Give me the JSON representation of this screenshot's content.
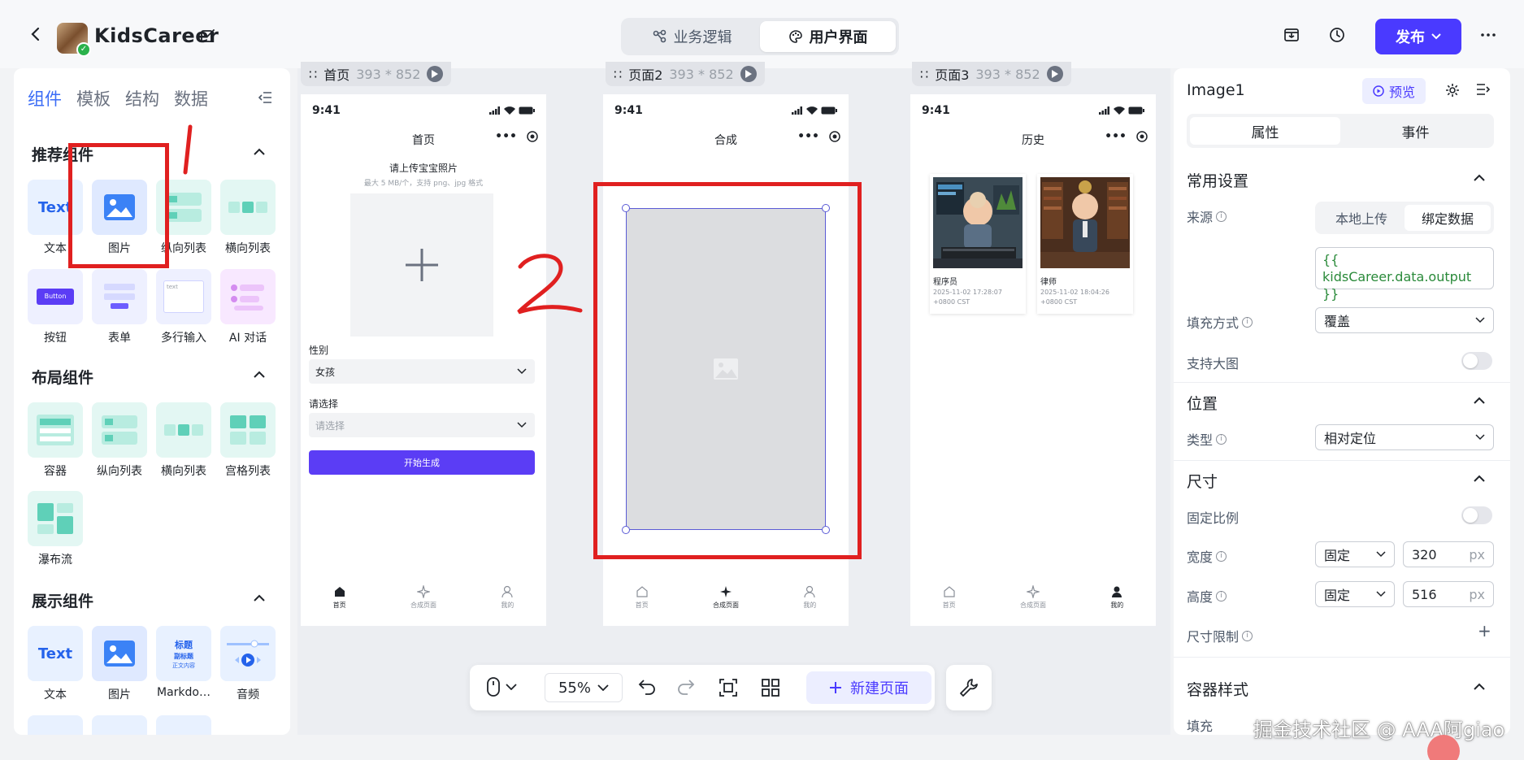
{
  "header": {
    "app_name": "KidsCareer",
    "modes": [
      {
        "label": "业务逻辑"
      },
      {
        "label": "用户界面"
      }
    ],
    "publish_label": "发布"
  },
  "left_panel": {
    "tabs": [
      "组件",
      "模板",
      "结构",
      "数据"
    ],
    "sections": {
      "recommended": {
        "title": "推荐组件",
        "items": [
          {
            "label": "文本",
            "icon": "text-icon",
            "thumb_text": "Text"
          },
          {
            "label": "图片",
            "icon": "image-icon"
          },
          {
            "label": "纵向列表",
            "icon": "vertical-list-icon"
          },
          {
            "label": "横向列表",
            "icon": "horizontal-list-icon"
          },
          {
            "label": "按钮",
            "icon": "button-icon",
            "thumb_text": "Button"
          },
          {
            "label": "表单",
            "icon": "form-icon"
          },
          {
            "label": "多行输入",
            "icon": "textarea-icon",
            "thumb_text": "text"
          },
          {
            "label": "AI 对话",
            "icon": "ai-chat-icon"
          }
        ]
      },
      "layout": {
        "title": "布局组件",
        "items": [
          {
            "label": "容器",
            "icon": "container-icon"
          },
          {
            "label": "纵向列表",
            "icon": "vertical-list-icon"
          },
          {
            "label": "横向列表",
            "icon": "horizontal-list-icon"
          },
          {
            "label": "宫格列表",
            "icon": "grid-list-icon"
          },
          {
            "label": "瀑布流",
            "icon": "waterfall-icon"
          }
        ]
      },
      "display": {
        "title": "展示组件",
        "items": [
          {
            "label": "文本",
            "icon": "text-icon",
            "thumb_text": "Text"
          },
          {
            "label": "图片",
            "icon": "image-icon"
          },
          {
            "label": "Markdo…",
            "icon": "markdown-icon",
            "thumb_lines": [
              "标题",
              "副标题",
              "正文内容"
            ]
          },
          {
            "label": "音频",
            "icon": "audio-icon"
          }
        ]
      }
    }
  },
  "canvas": {
    "pages": [
      {
        "name": "首页",
        "size": "393 * 852"
      },
      {
        "name": "页面2",
        "size": "393 * 852"
      },
      {
        "name": "页面3",
        "size": "393 * 852"
      }
    ],
    "status_time": "9:41",
    "page1": {
      "title": "首页",
      "upload_title": "请上传宝宝照片",
      "upload_hint": "最大 5 MB/个，支持 png、jpg 格式",
      "gender_label": "性别",
      "gender_value": "女孩",
      "select_label": "请选择",
      "select_placeholder": "请选择",
      "generate_button": "开始生成"
    },
    "page2": {
      "title": "合成"
    },
    "page3": {
      "title": "历史",
      "cards": [
        {
          "name": "程序员",
          "time": "2025-11-02 17:28:07 +0800 CST"
        },
        {
          "name": "律师",
          "time": "2025-11-02 18:04:26 +0800 CST"
        }
      ]
    },
    "tabbar": [
      {
        "label": "首页"
      },
      {
        "label": "合成页面"
      },
      {
        "label": "我的"
      }
    ],
    "annotations": {
      "one": "1",
      "two": "2"
    }
  },
  "toolbar": {
    "zoom": "55%",
    "new_page_label": "新建页面"
  },
  "right_panel": {
    "component_name": "Image1",
    "preview_label": "预览",
    "tabs": [
      "属性",
      "事件"
    ],
    "common": {
      "title": "常用设置",
      "source_label": "来源",
      "source_options": [
        "本地上传",
        "绑定数据"
      ],
      "binding": "{{ kidsCareer.data.output }}",
      "fill_label": "填充方式",
      "fill_value": "覆盖",
      "big_image_label": "支持大图"
    },
    "position": {
      "title": "位置",
      "type_label": "类型",
      "type_value": "相对定位"
    },
    "size": {
      "title": "尺寸",
      "fixed_ratio_label": "固定比例",
      "width_label": "宽度",
      "width_mode": "固定",
      "width_value": "320",
      "height_label": "高度",
      "height_mode": "固定",
      "height_value": "516",
      "unit": "px",
      "limit_label": "尺寸限制"
    },
    "container_style": {
      "title": "容器样式",
      "fill_label": "填充"
    }
  },
  "watermark": "掘金技术社区 @ AAA阿giao",
  "colors": {
    "accent": "#4a3aff",
    "annotation": "#e02020",
    "link": "#3b6cf6"
  }
}
